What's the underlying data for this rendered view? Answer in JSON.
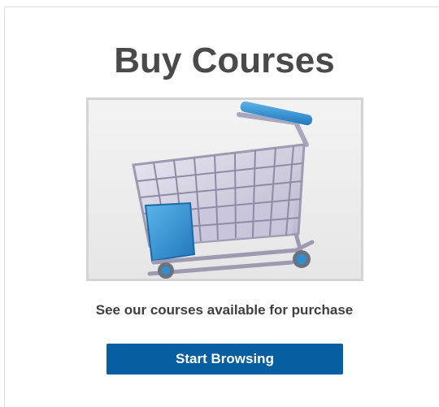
{
  "card": {
    "title": "Buy Courses",
    "image": {
      "icon": "shopping-cart-icon"
    },
    "subtitle": "See our courses available for purchase",
    "cta_label": "Start Browsing"
  },
  "colors": {
    "title_text": "#4a4a4a",
    "button_background": "#075ea0",
    "button_text": "#ffffff",
    "image_background": "#efefef",
    "cart_accent": "#2f8fd0"
  }
}
